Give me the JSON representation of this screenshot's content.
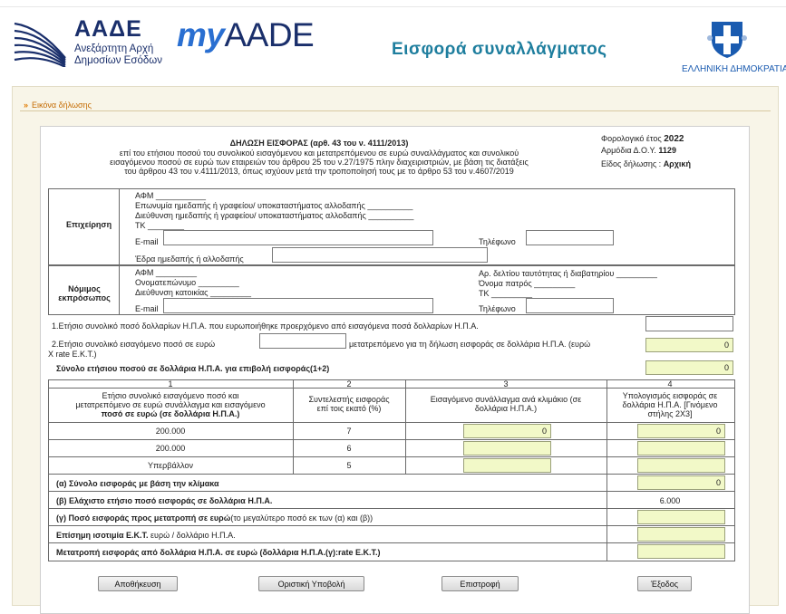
{
  "header": {
    "aade_title": "ΑΑΔΕ",
    "aade_sub1": "Ανεξάρτητη Αρχή",
    "aade_sub2": "Δημοσίων Εσόδων",
    "myaade_my": "my",
    "myaade_rest": "AADE",
    "page_title": "Εισφορά συναλλάγματος",
    "gov_label": "ΕΛΛΗΝΙΚΗ ΔΗΜΟΚΡΑΤΙΑ"
  },
  "breadcrumb": "Εικόνα δήλωσης",
  "declaration": {
    "title": "ΔΗΛΩΣΗ ΕΙΣΦΟΡΑΣ (αρθ. 43 του ν. 4111/2013)",
    "desc1": "επί του ετήσιου ποσού του συνολικού εισαγόμενου και μετατρεπόμενου σε ευρώ συναλλάγματος και συνολικού",
    "desc2": "εισαγόμενου ποσού σε ευρώ των εταιρειών του άρθρου 25 του ν.27/1975 πλην διαχειριστριών, με βάση τις διατάξεις",
    "desc3": "του άρθρου 43 του ν.4111/2013, όπως ισχύουν μετά την τροποποίησή τους με το άρθρο 53 του ν.4607/2019",
    "tax_year_label": "Φορολογικό έτος",
    "tax_year": "2022",
    "doy_label": "Αρμόδια Δ.Ο.Υ.",
    "doy": "1129",
    "type_label": "Είδος δήλωσης :",
    "type": "Αρχική"
  },
  "company": {
    "section_label": "Επιχείρηση",
    "afm": "ΑΦΜ ___________",
    "name": "Επωνυμία ημεδαπής ή γραφείου/ υποκαταστήματος αλλοδαπής     __________",
    "address": "Διεύθυνση ημεδαπής ή γραφείου/ υποκαταστήματος αλλοδαπής     __________",
    "tk": "ΤΚ  ________",
    "email_label": "E-mail",
    "phone_label": "Τηλέφωνο",
    "seat_label": "Έδρα ημεδαπής ή αλλοδαπής"
  },
  "representative": {
    "section_label1": "Νόμιμος",
    "section_label2": "εκπρόσωπος",
    "afm": "ΑΦΜ  _________",
    "name": "Ονοματεπώνυμο  _________",
    "address": "Διεύθυνση κατοικίας  _________",
    "email_label": "E-mail",
    "id_label": "Αρ. δελτίου ταυτότητας ή διαβατηρίου  _________",
    "father_label": "Όνομα πατρός  _________",
    "tk": "ΤΚ  _________",
    "phone_label": "Τηλέφωνο"
  },
  "lines": {
    "line1": "1.Ετήσιο συνολικό ποσό δολλαρίων Η.Π.Α. που ευρωποιήθηκε προερχόμενο από εισαγόμενα ποσά δολλαρίων Η.Π.Α.",
    "line2a": "2.Ετήσιο συνολικό εισαγόμενο ποσό σε ευρώ",
    "line2b": "μετατρεπόμενο για τη δήλωση εισφοράς σε δολλάρια Η.Π.Α. (ευρώ",
    "line2c": "X rate Ε.Κ.Τ.)",
    "line2_value": "0",
    "total_label": "Σύνολο ετήσιου ποσού σε δολλάρια Η.Π.Α. για επιβολή εισφοράς(1+2)",
    "total_value": "0"
  },
  "scale_table": {
    "col_numbers": [
      "1",
      "2",
      "3",
      "4"
    ],
    "col1_header": [
      "Ετήσιο συνολικό εισαγόμενο ποσό και",
      "μετατρεπόμενο σε ευρώ συνάλλαγμα και εισαγόμενο",
      "ποσό σε ευρώ (σε δολλάρια Η.Π.Α.)"
    ],
    "col2_header": [
      "Συντελεστής εισφοράς",
      "επί τοις εκατό (%)"
    ],
    "col3_header": [
      "Εισαγόμενο συνάλλαγμα ανά κλιμάκιο (σε",
      "δολλάρια Η.Π.Α.)"
    ],
    "col4_header": [
      "Υπολογισμός εισφοράς σε",
      "δολλάρια Η.Π.Α. [Γινόμενο",
      "στήλης 2Χ3]"
    ],
    "rows": [
      {
        "bracket": "200.000",
        "rate": "7",
        "amount": "0",
        "calc": "0"
      },
      {
        "bracket": "200.000",
        "rate": "6",
        "amount": "",
        "calc": ""
      },
      {
        "bracket": "Υπερβάλλον",
        "rate": "5",
        "amount": "",
        "calc": ""
      }
    ]
  },
  "summary": {
    "a_label": "(α) Σύνολο εισφοράς με βάση την κλίμακα",
    "a_value": "0",
    "b_label": "(β) Ελάχιστο ετήσιο ποσό εισφοράς σε δολλάρια Η.Π.Α.",
    "b_value": "6.000",
    "c_label_bold": "(γ) Ποσό εισφοράς προς μετατροπή σε ευρώ",
    "c_label_rest": "(το μεγαλύτερο ποσό εκ των (α) και (β))",
    "d_label_bold": "Επίσημη ισοτιμία Ε.Κ.Τ.",
    "d_label_rest": " ευρώ / δολλάριο Η.Π.Α.",
    "e_label": "Μετατροπή εισφοράς από δολλάρια Η.Π.Α. σε ευρώ (δολλάρια Η.Π.Α.(γ):rate Ε.Κ.Τ.)"
  },
  "buttons": {
    "save": "Αποθήκευση",
    "submit": "Οριστική Υποβολή",
    "back": "Επιστροφή",
    "exit": "Έξοδος"
  },
  "colors": {
    "brand": "#1a2f6b",
    "title": "#1e7e9e",
    "computed_field": "#f2f9c8",
    "breadcrumb": "#c46a00"
  }
}
